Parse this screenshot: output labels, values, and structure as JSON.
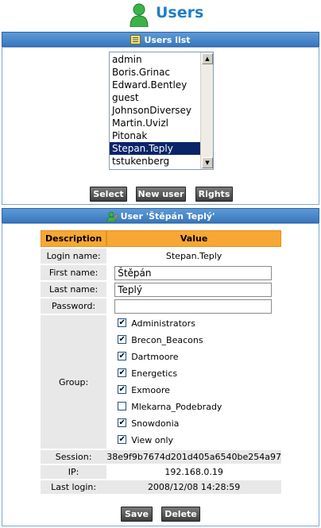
{
  "page_title": "Users",
  "users_list": {
    "header": "Users list",
    "items": [
      "admin",
      "Boris.Grinac",
      "Edward.Bentley",
      "guest",
      "JohnsonDiversey",
      "Martin.Uvizl",
      "Pitonak",
      "Stepan.Teply",
      "tstukenberg"
    ],
    "selected": "Stepan.Teply"
  },
  "buttons": {
    "select": "Select",
    "new_user": "New user",
    "rights": "Rights",
    "save": "Save",
    "delete": "Delete"
  },
  "user_panel": {
    "header": "User 'Štěpán Teplý'",
    "col_description": "Description",
    "col_value": "Value",
    "login_name_label": "Login name:",
    "login_name": "Stepan.Teply",
    "first_name_label": "First name:",
    "first_name": "Štěpán",
    "last_name_label": "Last name:",
    "last_name": "Teplý",
    "password_label": "Password:",
    "password": "",
    "group_label": "Group:",
    "groups": [
      {
        "name": "Administrators",
        "checked": true
      },
      {
        "name": "Brecon_Beacons",
        "checked": true
      },
      {
        "name": "Dartmoore",
        "checked": true
      },
      {
        "name": "Energetics",
        "checked": true
      },
      {
        "name": "Exmoore",
        "checked": true
      },
      {
        "name": "Mlekarna_Podebrady",
        "checked": false
      },
      {
        "name": "Snowdonia",
        "checked": true
      },
      {
        "name": "View only",
        "checked": true
      }
    ],
    "session_label": "Session:",
    "session": "38e9f9b7674d201d405a6540be254a97",
    "ip_label": "IP:",
    "ip": "192.168.0.19",
    "last_login_label": "Last login:",
    "last_login": "2008/12/08 14:28:59"
  },
  "colors": {
    "title_blue": "#1f7fc8",
    "bar_blue": "#3b78bd",
    "table_header_orange": "#f7a733",
    "selection": "#0a246a"
  },
  "icons": {
    "title": "user-icon",
    "users_list": "list-icon",
    "user_panel": "user-edit-icon",
    "checkbox_checked": "✔"
  }
}
